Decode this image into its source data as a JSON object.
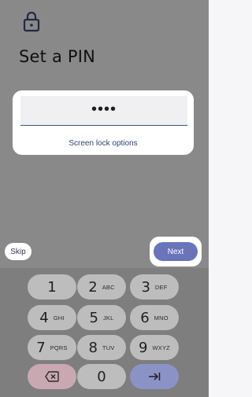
{
  "title": "Set a PIN",
  "pin": {
    "masked_value": "••••",
    "screen_lock_options_label": "Screen lock options"
  },
  "actions": {
    "skip_label": "Skip",
    "next_label": "Next"
  },
  "keypad": {
    "keys": [
      {
        "digit": "1",
        "letters": ""
      },
      {
        "digit": "2",
        "letters": "ABC"
      },
      {
        "digit": "3",
        "letters": "DEF"
      },
      {
        "digit": "4",
        "letters": "GHI"
      },
      {
        "digit": "5",
        "letters": "JKL"
      },
      {
        "digit": "6",
        "letters": "MNO"
      },
      {
        "digit": "7",
        "letters": "PQRS"
      },
      {
        "digit": "8",
        "letters": "TUV"
      },
      {
        "digit": "9",
        "letters": "WXYZ"
      },
      {
        "digit": "0",
        "letters": ""
      }
    ]
  },
  "icons": {
    "lock": "lock-icon",
    "backspace": "backspace-icon",
    "enter": "enter-icon"
  },
  "colors": {
    "accent": "#6a74bb",
    "field_underline": "#3d4f86",
    "backspace_key": "#caa8b2",
    "enter_key": "#8b93c6"
  }
}
